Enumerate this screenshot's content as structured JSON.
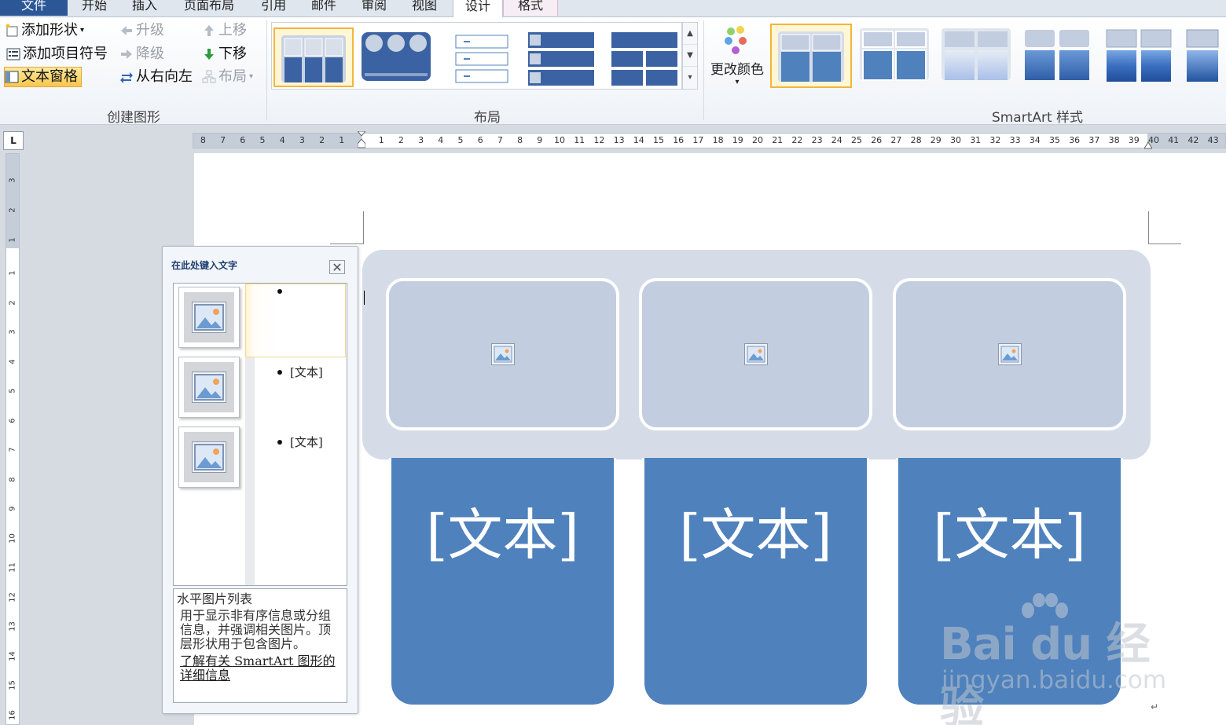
{
  "menu_tabs": [
    "文件",
    "开始",
    "插入",
    "页面布局",
    "引用",
    "邮件",
    "审阅",
    "视图",
    "设计",
    "格式"
  ],
  "active_tab": "设计",
  "ribbon": {
    "create_graphic": {
      "label": "创建图形",
      "add_shape": "添加形状",
      "add_bullet": "添加项目符号",
      "text_pane": "文本窗格",
      "promote": "升级",
      "demote": "降级",
      "right_to_left": "从右向左",
      "move_up": "上移",
      "move_down": "下移",
      "layout": "布局"
    },
    "layouts": {
      "label": "布局"
    },
    "styles": {
      "label": "SmartArt 样式",
      "change_colors": "更改颜色"
    }
  },
  "ruler": {
    "corner": "L",
    "left_numbers": [
      "8",
      "7",
      "6",
      "5",
      "4",
      "3",
      "2",
      "1"
    ],
    "right_numbers": [
      "1",
      "2",
      "3",
      "4",
      "5",
      "6",
      "7",
      "8",
      "9",
      "10",
      "11",
      "12",
      "13",
      "14",
      "15",
      "16",
      "17",
      "18",
      "19",
      "20",
      "21",
      "22",
      "23",
      "24",
      "25",
      "26",
      "27",
      "28",
      "29",
      "30",
      "31",
      "32",
      "33",
      "34",
      "35",
      "36",
      "37",
      "38",
      "39",
      "40",
      "41",
      "42",
      "43"
    ],
    "vertical_top": [
      "3",
      "2",
      "1"
    ],
    "vertical_main": [
      "1",
      "2",
      "3",
      "4",
      "5",
      "6",
      "7",
      "8",
      "9",
      "10",
      "11",
      "12",
      "13",
      "14",
      "15",
      "16"
    ]
  },
  "text_pane": {
    "title": "在此处键入文字",
    "items": [
      "",
      "[文本]",
      "[文本]"
    ],
    "description_title": "水平图片列表",
    "description": "用于显示非有序信息或分组信息，并强调相关图片。顶层形状用于包含图片。",
    "link": "了解有关 SmartArt 图形的详细信息"
  },
  "smartart": {
    "text_boxes": [
      "[文本]",
      "[文本]",
      "[文本]"
    ],
    "accent_color": "#4f81bd",
    "background_color": "#d5dce8",
    "picture_box_color": "#c3cde0"
  },
  "watermark": {
    "logo": "Bai du 经验",
    "url": "jingyan.baidu.com"
  }
}
